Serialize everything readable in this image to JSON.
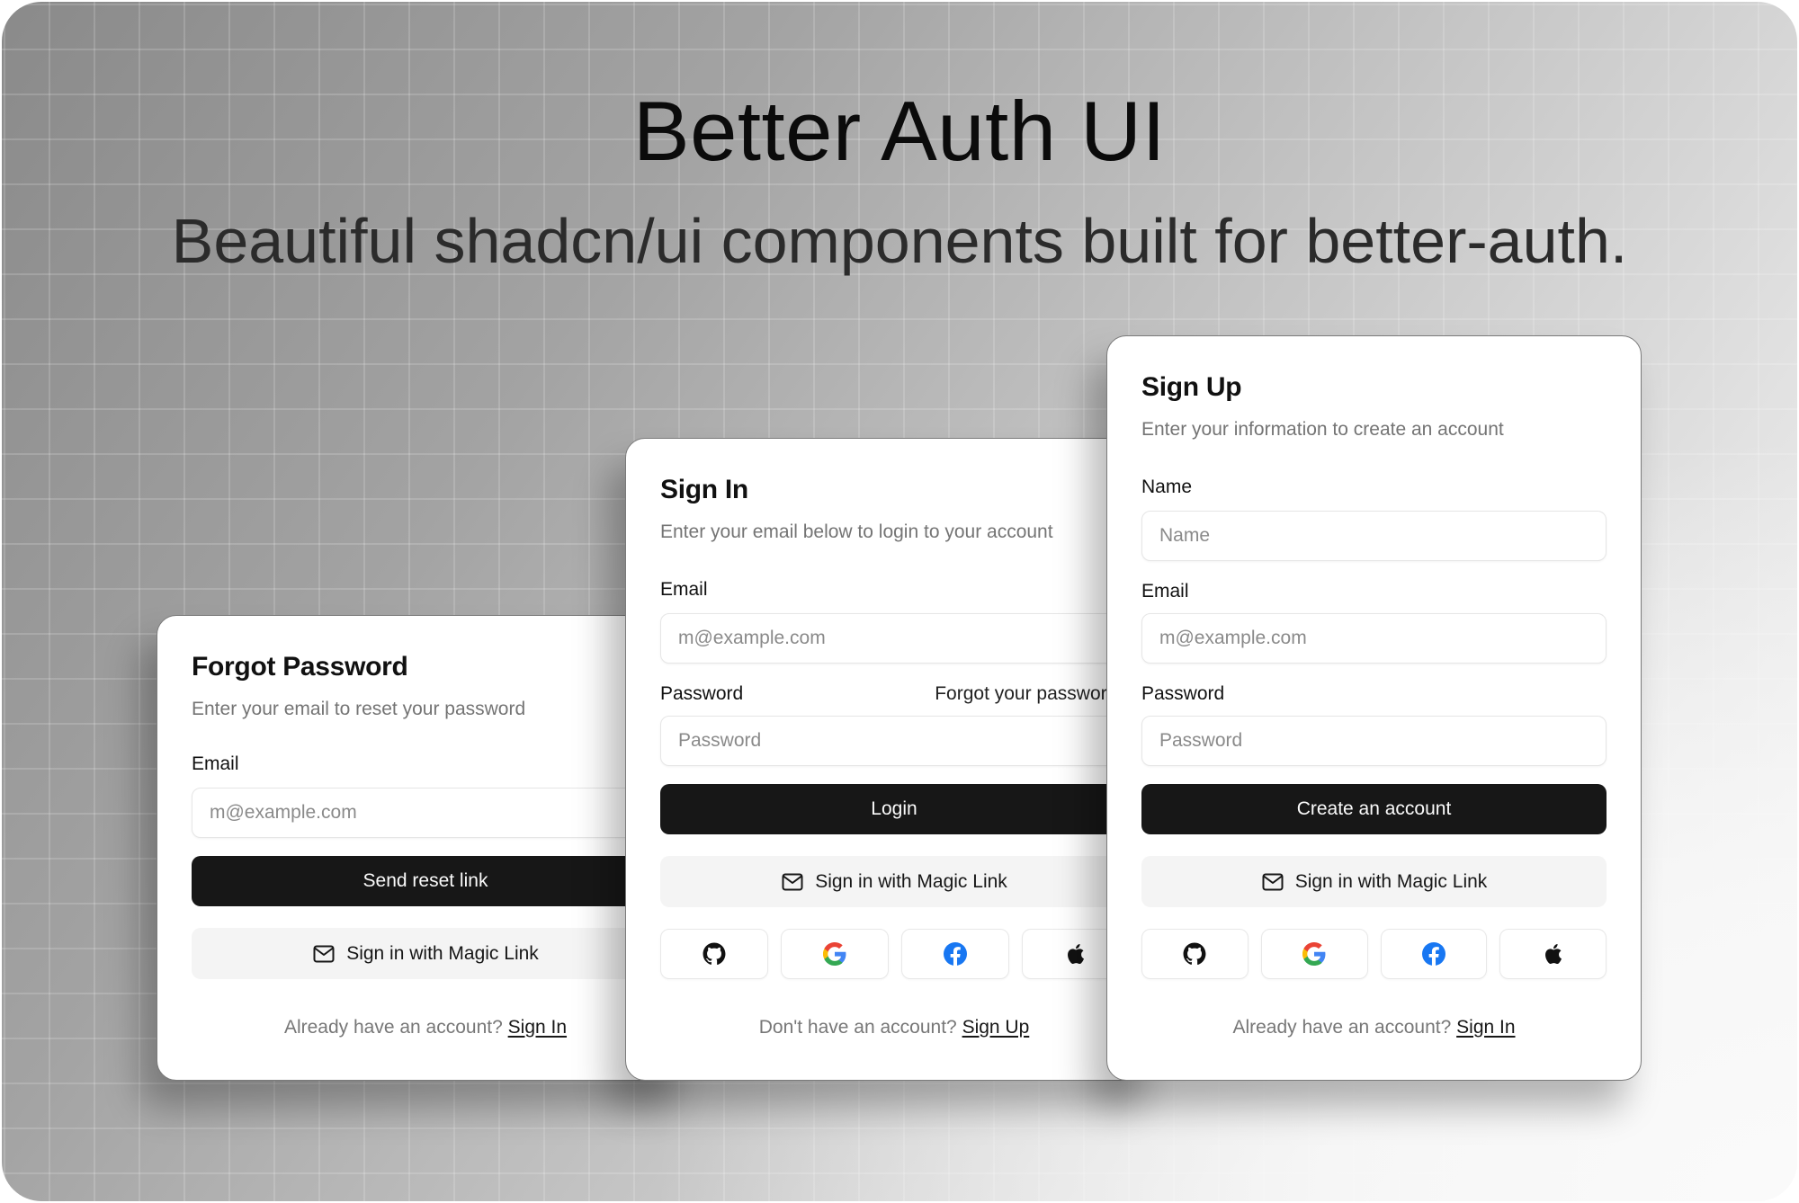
{
  "hero": {
    "title": "Better Auth UI",
    "subtitle": "Beautiful shadcn/ui components built for better-auth."
  },
  "colors": {
    "primary_button": "#171717",
    "secondary_button": "#f4f4f4",
    "muted_text": "#747474",
    "google_blue": "#4285F4",
    "google_red": "#EA4335",
    "google_yellow": "#FBBC05",
    "google_green": "#34A853",
    "facebook_blue": "#1877F2"
  },
  "forgot_password": {
    "title": "Forgot Password",
    "description": "Enter your email to reset your password",
    "email_label": "Email",
    "email_placeholder": "m@example.com",
    "submit_label": "Send reset link",
    "magic_link_label": "Sign in with Magic Link",
    "footer_text": "Already have an account?",
    "footer_link": "Sign In"
  },
  "sign_in": {
    "title": "Sign In",
    "description": "Enter your email below to login to your account",
    "email_label": "Email",
    "email_placeholder": "m@example.com",
    "password_label": "Password",
    "forgot_link": "Forgot your password?",
    "password_placeholder": "Password",
    "submit_label": "Login",
    "magic_link_label": "Sign in with Magic Link",
    "social_providers": [
      "github-icon",
      "google-icon",
      "facebook-icon",
      "apple-icon"
    ],
    "footer_text": "Don't have an account?",
    "footer_link": "Sign Up"
  },
  "sign_up": {
    "title": "Sign Up",
    "description": "Enter your information to create an account",
    "name_label": "Name",
    "name_placeholder": "Name",
    "email_label": "Email",
    "email_placeholder": "m@example.com",
    "password_label": "Password",
    "password_placeholder": "Password",
    "submit_label": "Create an account",
    "magic_link_label": "Sign in with Magic Link",
    "social_providers": [
      "github-icon",
      "google-icon",
      "facebook-icon",
      "apple-icon"
    ],
    "footer_text": "Already have an account?",
    "footer_link": "Sign In"
  }
}
